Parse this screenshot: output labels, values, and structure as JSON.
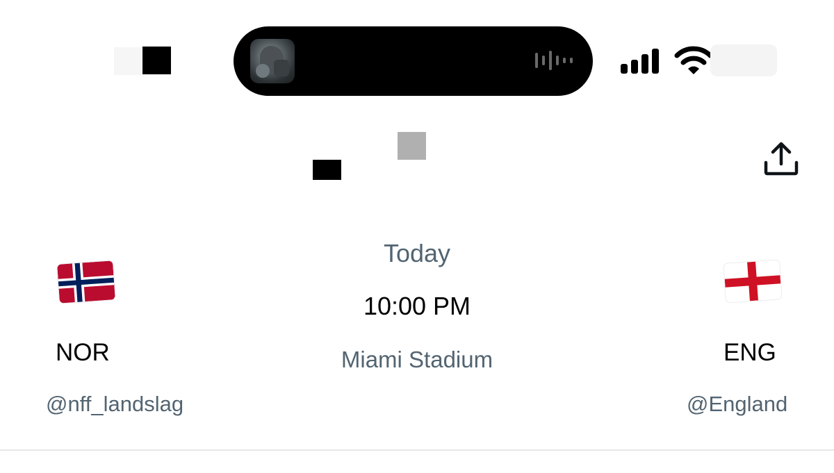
{
  "status_bar": {
    "island_art_icon": "album-artwork",
    "audio_icon": "waveform-icon",
    "signal_icon": "cellular-signal-icon",
    "wifi_icon": "wifi-icon"
  },
  "header": {
    "share_icon": "share-icon"
  },
  "match": {
    "home": {
      "code": "NOR",
      "handle": "@nff_landslag",
      "flag": "norway-flag"
    },
    "away": {
      "code": "ENG",
      "handle": "@England",
      "flag": "england-flag"
    },
    "day": "Today",
    "time": "10:00 PM",
    "venue": "Miami Stadium"
  },
  "colors": {
    "secondary_text": "#536471",
    "primary_text": "#000000",
    "divider": "#e4e6e8"
  }
}
